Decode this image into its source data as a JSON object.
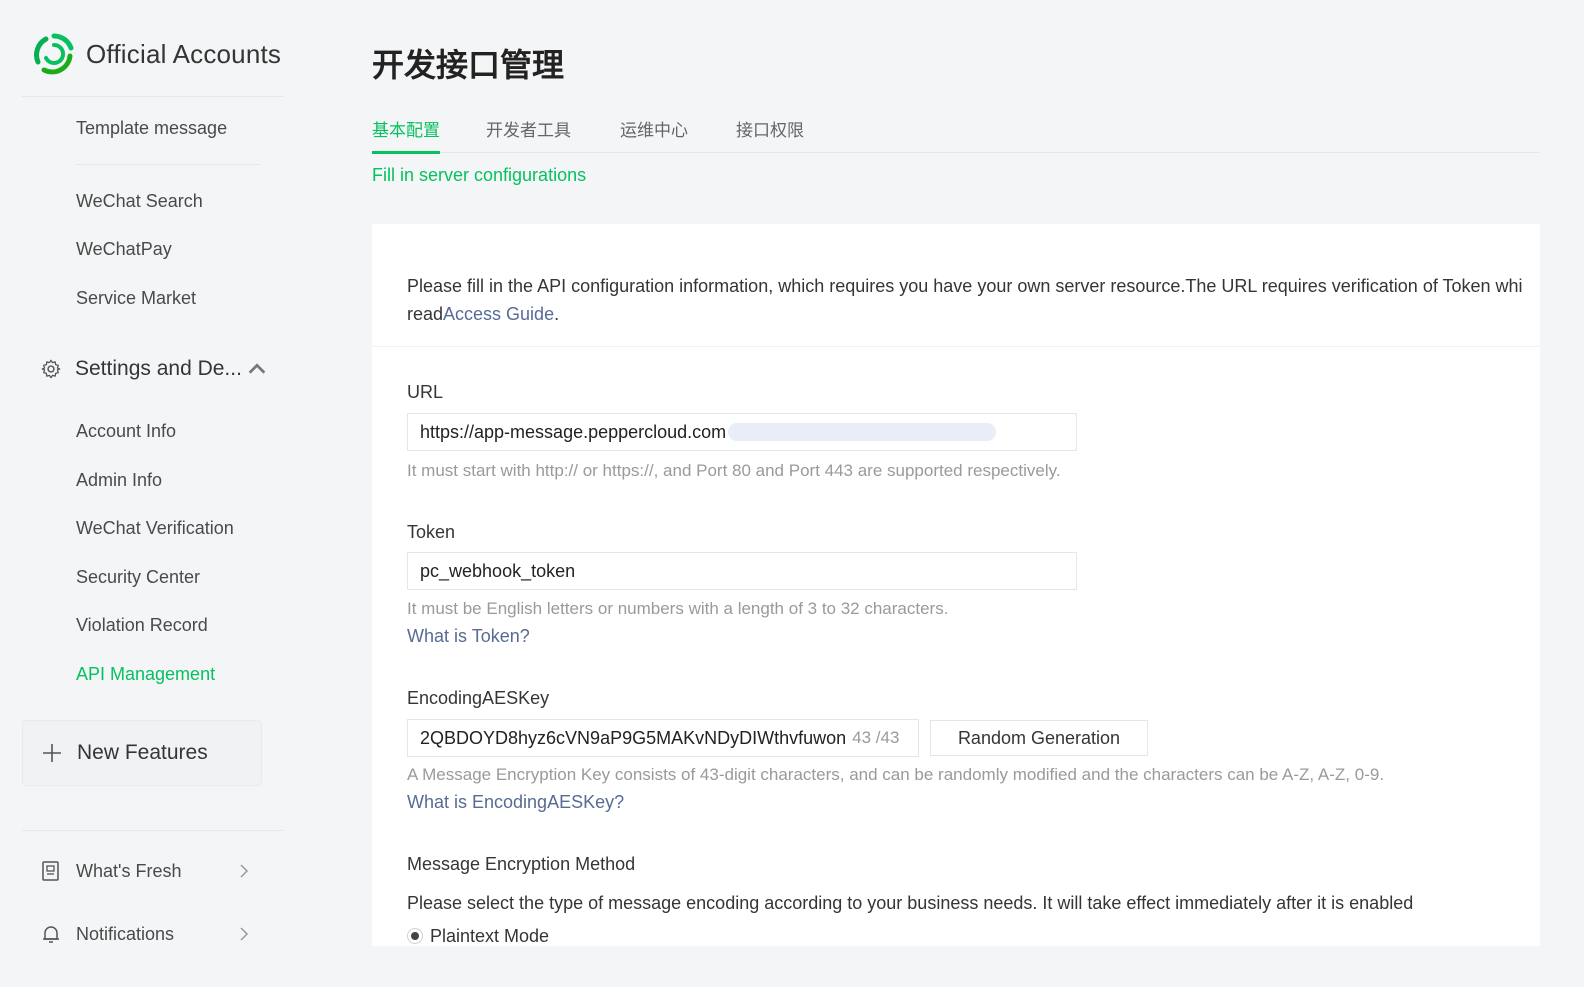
{
  "brand": {
    "title": "Official Accounts"
  },
  "sidebar": {
    "top_items": [
      {
        "label": "Template message"
      },
      {
        "label": "WeChat Search"
      },
      {
        "label": "WeChatPay"
      },
      {
        "label": "Service Market"
      }
    ],
    "group": {
      "label": "Settings and De...",
      "items": [
        {
          "label": "Account Info"
        },
        {
          "label": "Admin Info"
        },
        {
          "label": "WeChat Verification"
        },
        {
          "label": "Security Center"
        },
        {
          "label": "Violation Record"
        },
        {
          "label": "API Management",
          "active": true
        }
      ]
    },
    "new_features": "New Features",
    "bottom_items": [
      {
        "label": "What's Fresh"
      },
      {
        "label": "Notifications"
      }
    ]
  },
  "page": {
    "title": "开发接口管理",
    "tabs": [
      {
        "label": "基本配置",
        "active": true
      },
      {
        "label": "开发者工具"
      },
      {
        "label": "运维中心"
      },
      {
        "label": "接口权限"
      }
    ],
    "subnav": "Fill in server configurations"
  },
  "form": {
    "intro_line1": "Please fill in the API configuration information, which requires you have your own server resource.The URL requires verification of Token whi",
    "intro_read": "read",
    "intro_link": "Access Guide",
    "intro_end": ".",
    "url": {
      "label": "URL",
      "value": "https://app-message.peppercloud.com",
      "hint": "It must start with http:// or https://, and Port 80 and Port 443 are supported respectively."
    },
    "token": {
      "label": "Token",
      "value": "pc_webhook_token",
      "hint": "It must be English letters or numbers with a length of 3 to 32 characters.",
      "help": "What is Token?"
    },
    "aes": {
      "label": "EncodingAESKey",
      "value": "2QBDOYD8hyz6cVN9aP9G5MAKvNDyDIWthvfuwon",
      "counter": "43 /43",
      "button": "Random Generation",
      "hint": "A Message Encryption Key consists of 43-digit characters, and can be randomly modified and the characters can be A-Z, A-Z, 0-9.",
      "help": "What is EncodingAESKey?"
    },
    "encryption": {
      "label": "Message Encryption Method",
      "desc": "Please select the type of message encoding according to your business needs. It will take effect immediately after it is enabled",
      "option": "Plaintext Mode"
    }
  },
  "colors": {
    "accent": "#07c160",
    "link": "#576b95",
    "background": "#f4f5f6"
  },
  "icons": {
    "logo": "wechat-official-logo",
    "settings": "gear-icon",
    "new": "plus-icon",
    "fresh": "book-icon",
    "notify": "bell-icon",
    "chevron": "chevron-right-icon"
  }
}
